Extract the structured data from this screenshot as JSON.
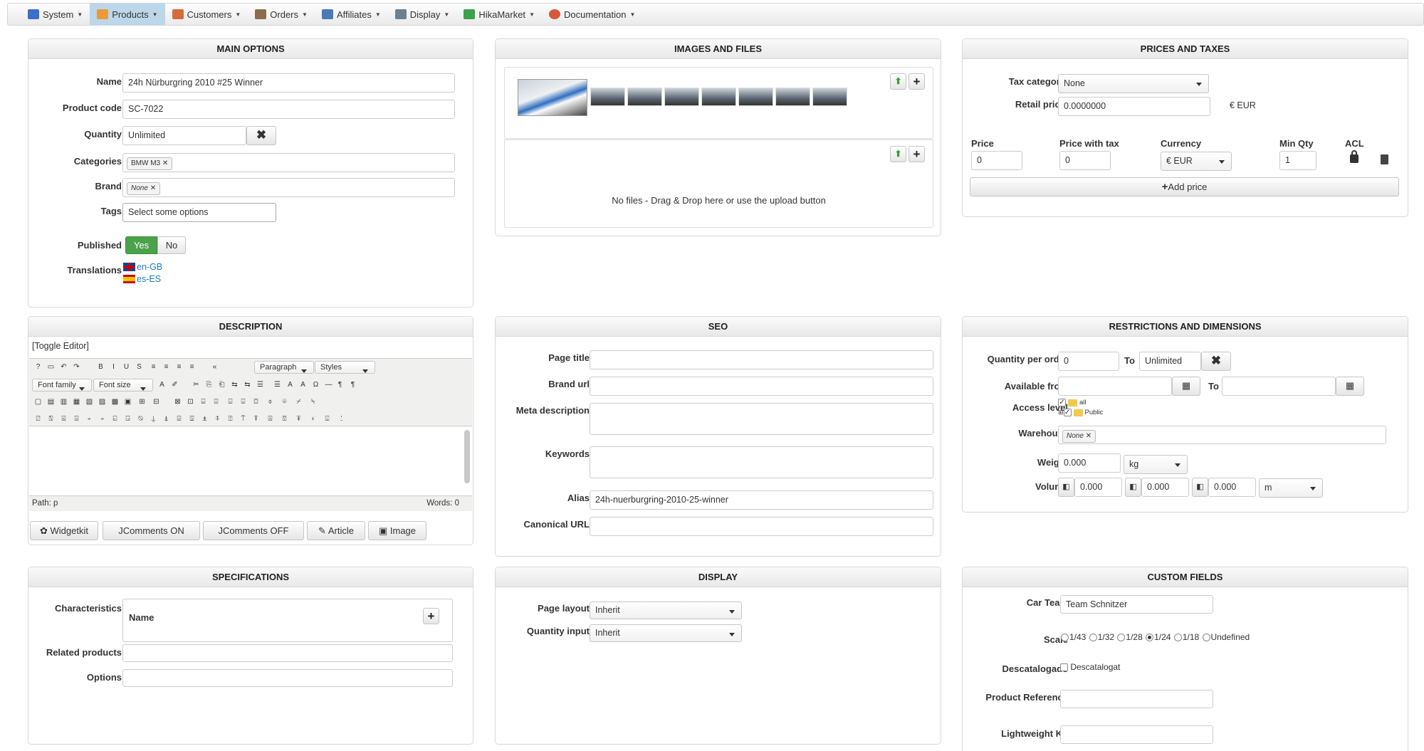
{
  "menu": [
    {
      "label": "System",
      "icon": "system-icon",
      "color": "#3a70c9"
    },
    {
      "label": "Products",
      "icon": "products-icon",
      "color": "#e89a3c",
      "active": true
    },
    {
      "label": "Customers",
      "icon": "customers-icon",
      "color": "#d66a3a"
    },
    {
      "label": "Orders",
      "icon": "orders-icon",
      "color": "#8a6d4a"
    },
    {
      "label": "Affiliates",
      "icon": "affiliates-icon",
      "color": "#4a7ab9"
    },
    {
      "label": "Display",
      "icon": "display-icon",
      "color": "#6b8090"
    },
    {
      "label": "HikaMarket",
      "icon": "hikamarket-icon",
      "color": "#3aa34c"
    },
    {
      "label": "Documentation",
      "icon": "documentation-icon",
      "color": "#d45a3a"
    }
  ],
  "main_options": {
    "title": "MAIN OPTIONS",
    "name_label": "Name",
    "name_value": "24h Nürburgring 2010 #25 Winner",
    "code_label": "Product code",
    "code_value": "SC-7022",
    "quantity_label": "Quantity",
    "quantity_value": "Unlimited",
    "categories_label": "Categories",
    "category_chip": "BMW M3",
    "brand_label": "Brand",
    "brand_chip": "None",
    "tags_label": "Tags",
    "tags_placeholder": "Select some options",
    "published_label": "Published",
    "published_yes": "Yes",
    "published_no": "No",
    "translations_label": "Translations",
    "translations": [
      "en-GB",
      "es-ES"
    ]
  },
  "images": {
    "title": "IMAGES AND FILES",
    "no_files": "No files - Drag & Drop here or use the upload button"
  },
  "prices": {
    "title": "PRICES AND TAXES",
    "tax_label": "Tax category",
    "tax_value": "None",
    "retail_label": "Retail price",
    "retail_value": "0.0000000",
    "retail_currency": "€ EUR",
    "col_price": "Price",
    "col_price_tax": "Price with tax",
    "col_currency": "Currency",
    "col_min_qty": "Min Qty",
    "col_acl": "ACL",
    "price_value": "0",
    "price_tax_value": "0",
    "currency_value": "€ EUR",
    "min_qty_value": "1",
    "add_price": "Add price"
  },
  "description": {
    "title": "DESCRIPTION",
    "toggle": "[Toggle Editor]",
    "paragraph": "Paragraph",
    "styles": "Styles",
    "font_family": "Font family",
    "font_size": "Font size",
    "path": "Path: p",
    "words": "Words: 0",
    "buttons": [
      "Widgetkit",
      "JComments ON",
      "JComments OFF",
      "Article",
      "Image"
    ]
  },
  "seo": {
    "title": "SEO",
    "page_title": "Page title",
    "brand_url": "Brand url",
    "meta_description": "Meta description",
    "keywords": "Keywords",
    "alias_label": "Alias",
    "alias_value": "24h-nuerburgring-2010-25-winner",
    "canonical": "Canonical URL"
  },
  "restrictions": {
    "title": "RESTRICTIONS AND DIMENSIONS",
    "qty_per_order": "Quantity per order",
    "qty_from": "0",
    "to": "To",
    "qty_to": "Unlimited",
    "available_from": "Available from",
    "to2": "To",
    "access_level": "Access level",
    "access_all": "all",
    "access_public": "Public",
    "warehouse": "Warehouse",
    "warehouse_chip": "None",
    "weight": "Weight",
    "weight_value": "0.000",
    "weight_unit": "kg",
    "volume": "Volume",
    "vol_values": [
      "0.000",
      "0.000",
      "0.000"
    ],
    "vol_unit": "m"
  },
  "specifications": {
    "title": "SPECIFICATIONS",
    "characteristics": "Characteristics",
    "name_col": "Name",
    "related": "Related products",
    "options": "Options"
  },
  "display": {
    "title": "DISPLAY",
    "page_layout": "Page layout",
    "page_layout_value": "Inherit",
    "quantity_input": "Quantity input",
    "quantity_input_value": "Inherit"
  },
  "custom": {
    "title": "CUSTOM FIELDS",
    "car_team": "Car Team",
    "car_team_value": "Team Schnitzer",
    "scale": "Scale",
    "scale_options": [
      "1/43",
      "1/32",
      "1/28",
      "1/24",
      "1/18",
      "Undefined"
    ],
    "scale_selected": "1/24",
    "descatalogado": "Descatalogado",
    "descatalogado_option": "Descatalogat",
    "product_reference": "Product Reference",
    "lightweight_kit": "Lightweight Kit"
  }
}
